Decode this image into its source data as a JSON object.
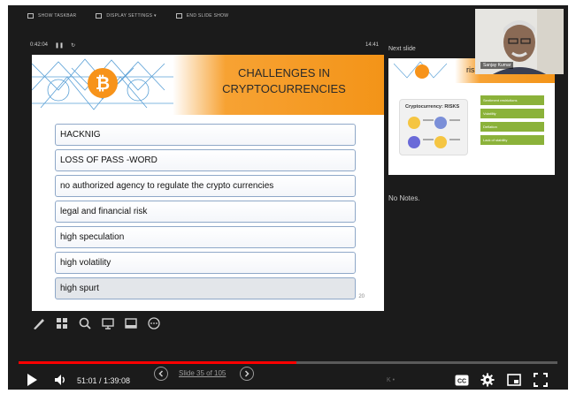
{
  "toolbar": {
    "items": [
      {
        "label": "SHOW TASKBAR",
        "icon": "taskbar-icon"
      },
      {
        "label": "DISPLAY SETTINGS ▾",
        "icon": "display-settings-icon"
      },
      {
        "label": "END SLIDE SHOW",
        "icon": "end-show-icon"
      }
    ]
  },
  "presenter": {
    "elapsed": "0:42:04",
    "clock": "14:41",
    "next_label": "Next slide",
    "notes": "No Notes."
  },
  "slide": {
    "title_line1": "CHALLENGES IN",
    "title_line2": "CRYPTOCURRENCIES",
    "items": [
      "HACKNIG",
      "LOSS OF PASS -WORD",
      "no authorized agency to regulate the crypto currencies",
      "legal and financial risk",
      "high speculation",
      "high volatility",
      "high spurt"
    ],
    "corner": "20"
  },
  "next_slide": {
    "title": "risk and failure",
    "card_title": "Cryptocurrency: RISKS",
    "pills": [
      "Sentiment restrictions",
      "Volatility",
      "Deflation",
      "Lack of stability"
    ]
  },
  "webcam": {
    "name": "Sanjay Kumar"
  },
  "player": {
    "time": "51:01 / 1:39:08",
    "slide_count": "Slide 35 of 105",
    "progress": 0.515,
    "sub_info": "K  •"
  },
  "colors": {
    "accent_orange": "#f39418",
    "progress_red": "#ff0000",
    "list_border": "#8fa8c8",
    "pill_green": "#8bb23a"
  }
}
